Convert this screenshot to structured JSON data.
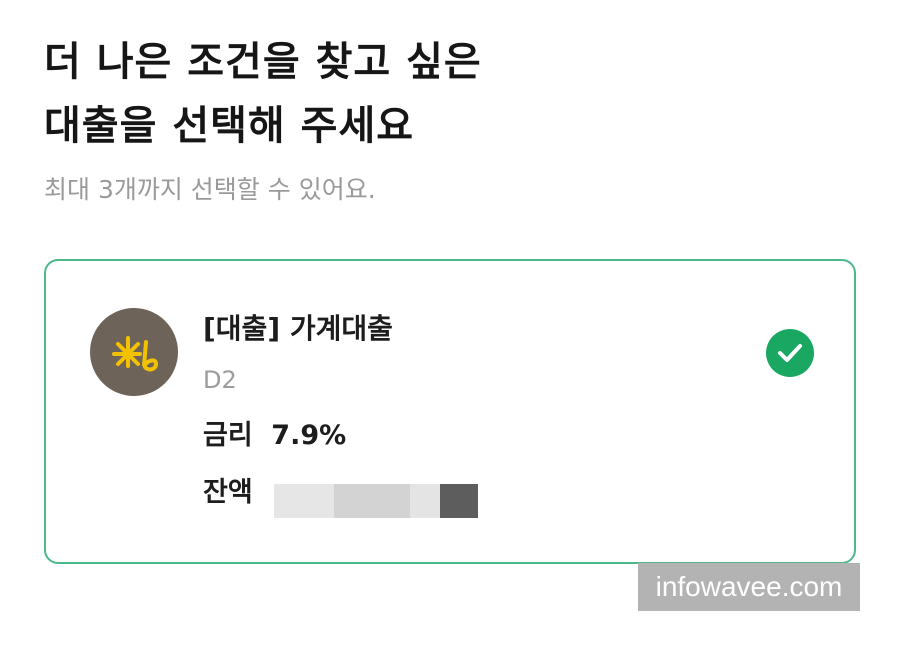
{
  "header": {
    "title_line1": "더 나은 조건을 찾고 싶은",
    "title_line2": "대출을 선택해 주세요",
    "subtitle": "최대 3개까지 선택할 수 있어요."
  },
  "loan_card": {
    "logo_icon": "kb-star-logo-icon",
    "name": "[대출] 가계대출",
    "sub_text": "D2",
    "rate_label": "금리",
    "rate_value": "7.9%",
    "balance_label": "잔액",
    "selected": true,
    "accent_color": "#1aa761",
    "border_color": "#4cb98a",
    "logo_bg": "#6e6358",
    "logo_mark_color": "#f2c200"
  },
  "watermark": {
    "text": "infowavee.com"
  }
}
